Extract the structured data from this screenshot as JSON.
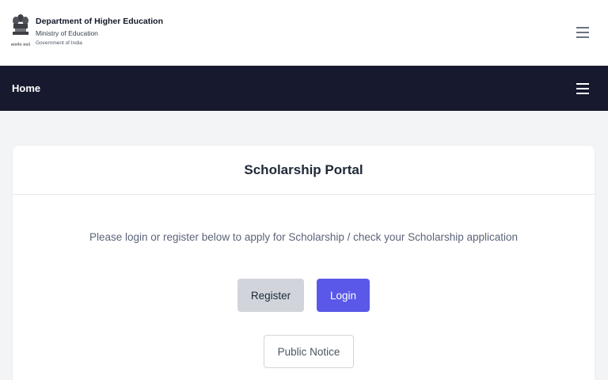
{
  "header": {
    "title": "Department of Higher Education",
    "subtitle": "Ministry of Education",
    "subtitle2": "Government of India",
    "emblem_caption": "सत्यमेव जयते",
    "menu_icon": "hamburger-icon"
  },
  "nav": {
    "home_label": "Home",
    "menu_icon": "hamburger-icon"
  },
  "main": {
    "card_title": "Scholarship Portal",
    "description": "Please login or register below to apply for Scholarship / check your Scholarship application",
    "register_label": "Register",
    "login_label": "Login",
    "public_notice_label": "Public Notice"
  },
  "colors": {
    "navbar_bg": "#171a2e",
    "login_bg": "#5a58e8",
    "register_bg": "#d1d5db",
    "page_bg": "#f3f4f6"
  }
}
